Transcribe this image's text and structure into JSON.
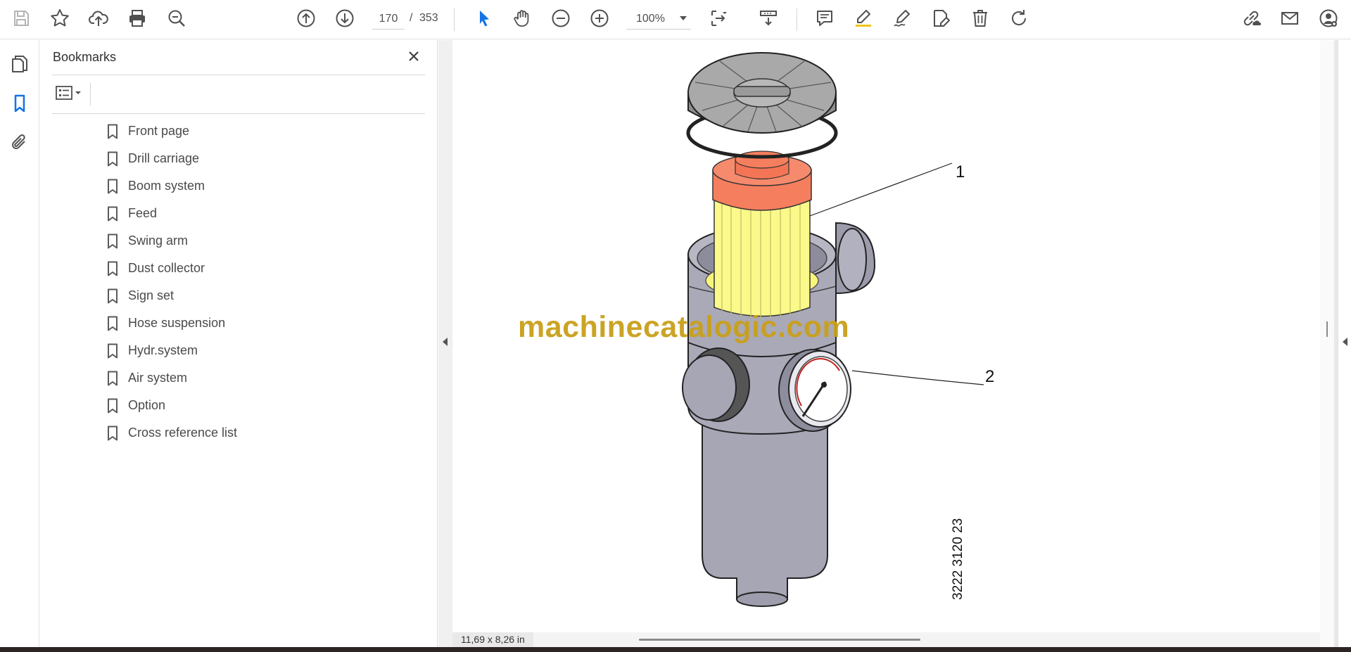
{
  "toolbar": {
    "current_page": "170",
    "page_separator": "/",
    "total_pages": "353",
    "zoom": "100%"
  },
  "icons": {
    "save": "save-icon",
    "star": "star-icon",
    "upload": "cloud-upload-icon",
    "print": "print-icon",
    "find": "magnify-icon",
    "prev": "arrow-up-circle-icon",
    "next": "arrow-down-circle-icon",
    "zoom_out": "minus-circle-icon",
    "zoom_in": "plus-circle-icon",
    "select": "cursor-icon",
    "hand": "hand-icon",
    "fit": "fit-page-icon",
    "scroll_mode": "scroll-mode-icon",
    "comment": "comment-icon",
    "highlight": "highlight-pen-icon",
    "sign": "sign-pen-icon",
    "fill_sign": "fill-sign-icon",
    "delete": "trash-icon",
    "rotate": "rotate-icon",
    "share_link": "share-link-icon",
    "email": "email-icon",
    "account": "account-icon"
  },
  "colors": {
    "accent": "#1473e6",
    "watermark": "#c9a01a",
    "filter_cap": "#f57e5e",
    "filter_element": "#fbf98a",
    "housing": "#a7a6b5"
  },
  "bookmarks": {
    "title": "Bookmarks",
    "items": [
      "Front page",
      "Drill carriage",
      "Boom system",
      "Feed",
      "Swing arm",
      "Dust collector",
      "Sign set",
      "Hose suspension",
      "Hydr.system",
      "Air system",
      "Option",
      "Cross reference list"
    ]
  },
  "document": {
    "watermark": "machinecatalogic.com",
    "callout_1": "1",
    "callout_2": "2",
    "part_number": "3222 3120 23",
    "page_size": "11,69 x 8,26 in"
  }
}
